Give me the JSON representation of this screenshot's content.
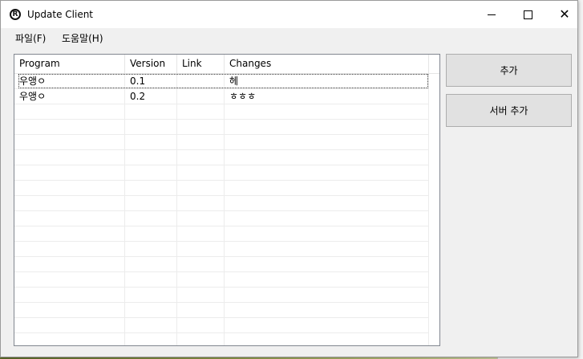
{
  "window": {
    "title": "Update Client",
    "icon": "registered-r-icon"
  },
  "menu": {
    "items": [
      {
        "label": "파일(F)"
      },
      {
        "label": "도움말(H)"
      }
    ]
  },
  "table": {
    "columns": [
      "Program",
      "Version",
      "Link",
      "Changes"
    ],
    "rows": [
      {
        "program": "우앵ㅇ",
        "version": "0.1",
        "link": "",
        "changes": "헤",
        "selected": true
      },
      {
        "program": "우앵ㅇ",
        "version": "0.2",
        "link": "",
        "changes": "ㅎㅎㅎ",
        "selected": false
      }
    ]
  },
  "buttons": {
    "add": "추가",
    "add_server": "서버 추가"
  },
  "colors": {
    "button_face": "#e1e1e1",
    "client_bg": "#f0f0f0"
  }
}
